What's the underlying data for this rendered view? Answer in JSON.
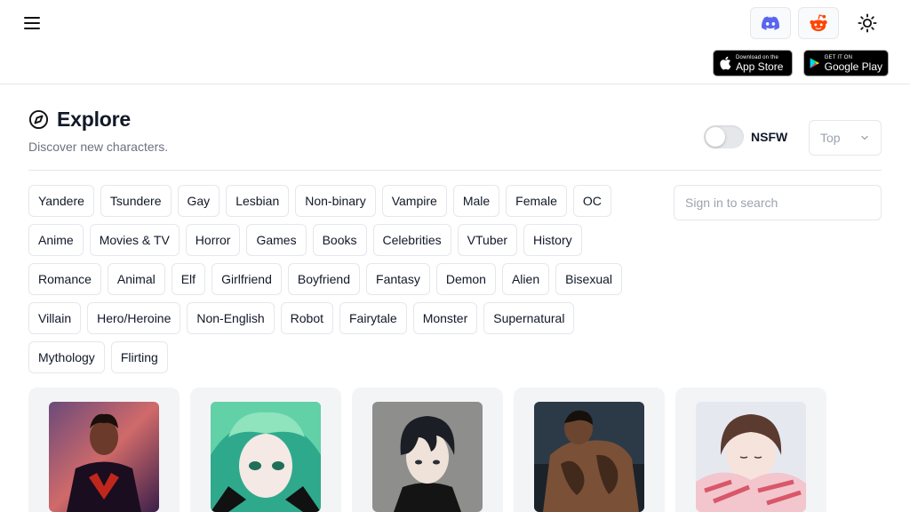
{
  "header": {
    "menu_icon": "hamburger-menu-icon",
    "discord_icon": "discord-icon",
    "reddit_icon": "reddit-icon",
    "theme_icon": "sun-icon",
    "appstore": {
      "small": "Download on the",
      "big": "App Store"
    },
    "googleplay": {
      "small": "GET IT ON",
      "big": "Google Play"
    },
    "colors": {
      "discord": "#5865F2",
      "reddit": "#FF4500"
    }
  },
  "explore": {
    "title": "Explore",
    "icon": "compass-icon",
    "subtitle": "Discover new characters.",
    "nsfw_label": "NSFW",
    "nsfw_enabled": false,
    "sort_value": "Top",
    "search_placeholder": "Sign in to search"
  },
  "tags": [
    [
      "Yandere",
      "Tsundere",
      "Gay",
      "Lesbian",
      "Non-binary",
      "Vampire",
      "Male",
      "Female",
      "OC"
    ],
    [
      "Anime",
      "Movies & TV",
      "Horror",
      "Games",
      "Books",
      "Celebrities",
      "VTuber",
      "History"
    ],
    [
      "Romance",
      "Animal",
      "Elf",
      "Girlfriend",
      "Boyfriend",
      "Fantasy",
      "Demon",
      "Alien",
      "Bisexual"
    ],
    [
      "Villain",
      "Hero/Heroine",
      "Non-English",
      "Robot",
      "Fairytale",
      "Monster",
      "Supernatural"
    ],
    [
      "Mythology",
      "Flirting"
    ]
  ],
  "cards": [
    {
      "image": "character-portrait-spider-hero"
    },
    {
      "image": "character-portrait-green-hair"
    },
    {
      "image": "character-portrait-dark-hair-boy"
    },
    {
      "image": "character-portrait-tattooed-man"
    },
    {
      "image": "character-portrait-sleeping-girl"
    }
  ]
}
